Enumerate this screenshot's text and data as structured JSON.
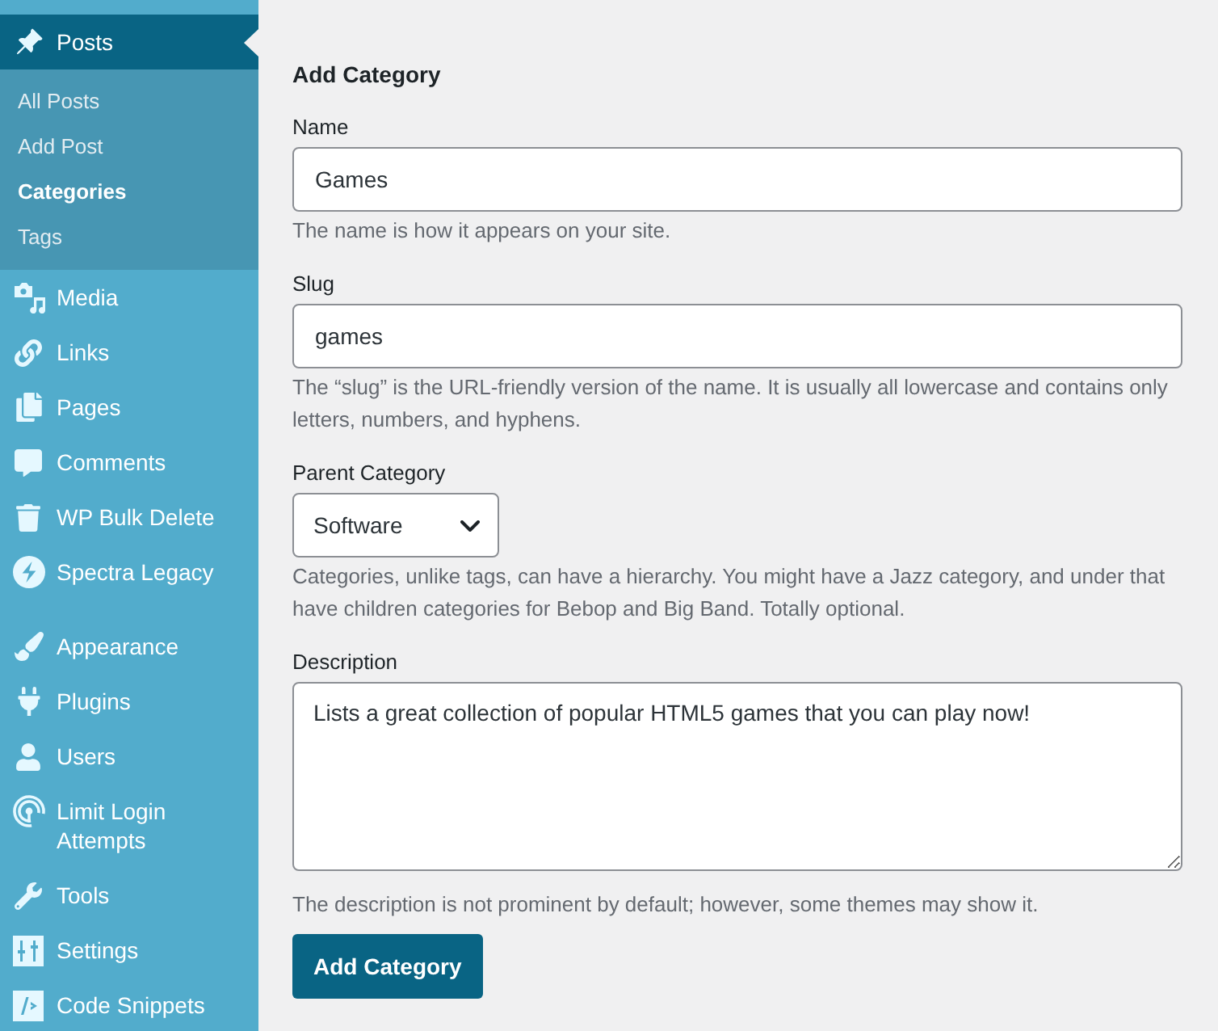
{
  "sidebar": {
    "sections": [
      {
        "items": [
          {
            "label": "Posts",
            "selected": true,
            "children": [
              {
                "label": "All Posts",
                "selected": false
              },
              {
                "label": "Add Post",
                "selected": false
              },
              {
                "label": "Categories",
                "selected": true
              },
              {
                "label": "Tags",
                "selected": false
              }
            ]
          },
          {
            "label": "Media",
            "selected": false
          },
          {
            "label": "Links",
            "selected": false
          },
          {
            "label": "Pages",
            "selected": false
          },
          {
            "label": "Comments",
            "selected": false
          },
          {
            "label": "WP Bulk Delete",
            "selected": false
          },
          {
            "label": "Spectra Legacy",
            "selected": false
          }
        ]
      },
      {
        "items": [
          {
            "label": "Appearance",
            "selected": false
          },
          {
            "label": "Plugins",
            "selected": false
          },
          {
            "label": "Users",
            "selected": false
          },
          {
            "label": "Limit Login Attempts",
            "selected": false
          },
          {
            "label": "Tools",
            "selected": false
          },
          {
            "label": "Settings",
            "selected": false
          },
          {
            "label": "Code Snippets",
            "selected": false
          }
        ]
      }
    ]
  },
  "form": {
    "title": "Add Category",
    "fields": [
      {
        "kind": "text",
        "label": "Name",
        "value": "Games",
        "help": "The name is how it appears on your site."
      },
      {
        "kind": "text",
        "label": "Slug",
        "value": "games",
        "help": "The “slug” is the URL-friendly version of the name. It is usually all lowercase and contains only letters, numbers, and hyphens."
      },
      {
        "kind": "select",
        "label": "Parent Category",
        "value": "Software",
        "help": "Categories, unlike tags, can have a hierarchy. You might have a Jazz category, and under that have children categories for Bebop and Big Band. Totally optional."
      },
      {
        "kind": "textarea",
        "label": "Description",
        "value": "Lists a great collection of popular HTML5 games that you can play now!",
        "help": "The description is not prominent by default; however, some themes may show it."
      }
    ],
    "submit": "Add Category"
  }
}
